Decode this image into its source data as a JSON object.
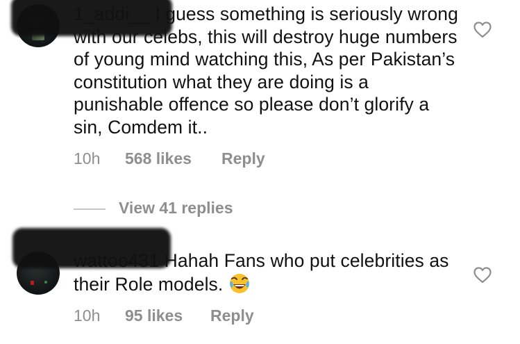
{
  "comments": [
    {
      "username": "1_addi__",
      "text": "I guess something is seriously wrong with our celebs, this will destroy huge numbers of young mind watching this, As per Pakistan’s constitution what they are doing is a punishable offence so please don’t glorify a sin, Comdem it..",
      "time": "10h",
      "likes": "568 likes",
      "reply_label": "Reply",
      "view_replies": "View 41 replies"
    },
    {
      "username": "wattoo431",
      "text": "Hahah Fans who put celebrities as their Role models.",
      "emoji": "face-with-tears-of-joy",
      "time": "10h",
      "likes": "95 likes",
      "reply_label": "Reply"
    }
  ],
  "colors": {
    "text": "#111111",
    "meta": "#8e8e8e",
    "divider": "#c7c7c7",
    "heart_outline": "#8e8e8e"
  },
  "icons": [
    "heart-outline-icon",
    "avatar",
    "face-with-tears-of-joy"
  ]
}
